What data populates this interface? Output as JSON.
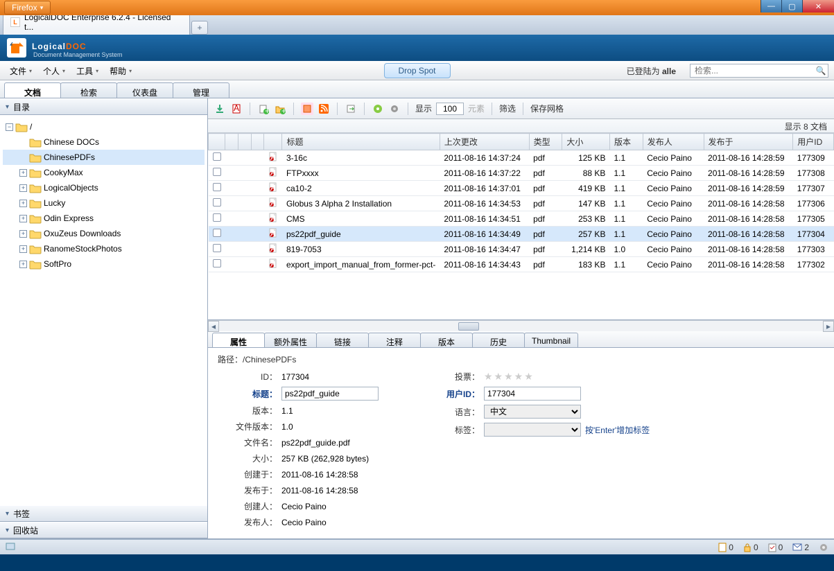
{
  "browser": {
    "name": "Firefox",
    "tab_title": "LogicalDOC Enterprise 6.2.4 - Licensed t..."
  },
  "logo": {
    "brand1": "Logical",
    "brand2": "DOC",
    "sub": "Document Management System"
  },
  "menus": {
    "file": "文件",
    "personal": "个人",
    "tools": "工具",
    "help": "帮助"
  },
  "dropspot": "Drop Spot",
  "login": {
    "prefix": "已登陆为 ",
    "user": "alle"
  },
  "search_placeholder": "检索...",
  "main_tabs": {
    "docs": "文档",
    "search": "检索",
    "dashboard": "仪表盘",
    "admin": "管理"
  },
  "sidebar": {
    "dir": "目录",
    "bookmarks": "书签",
    "trash": "回收站",
    "root": "/",
    "folders": [
      {
        "name": "Chinese DOCs",
        "expandable": false
      },
      {
        "name": "ChinesePDFs",
        "expandable": false,
        "selected": true
      },
      {
        "name": "CookyMax",
        "expandable": true
      },
      {
        "name": "LogicalObjects",
        "expandable": true
      },
      {
        "name": "Lucky",
        "expandable": true
      },
      {
        "name": "Odin Express",
        "expandable": true
      },
      {
        "name": "OxuZeus Downloads",
        "expandable": true
      },
      {
        "name": "RanomeStockPhotos",
        "expandable": true
      },
      {
        "name": "SoftPro",
        "expandable": true
      }
    ]
  },
  "toolbar": {
    "show": "显示",
    "page_size": "100",
    "elements": "元素",
    "filter": "筛选",
    "save_grid": "保存网格"
  },
  "count_text": "显示 8 文档",
  "columns": {
    "title": "标题",
    "modified": "上次更改",
    "type": "类型",
    "size": "大小",
    "version": "版本",
    "publisher": "发布人",
    "published": "发布于",
    "userid": "用户ID"
  },
  "rows": [
    {
      "title": "3-16c",
      "modified": "2011-08-16 14:37:24",
      "type": "pdf",
      "size": "125 KB",
      "version": "1.1",
      "pub": "Cecio Paino",
      "pubdate": "2011-08-16 14:28:59",
      "uid": "177309"
    },
    {
      "title": "FTPxxxx",
      "modified": "2011-08-16 14:37:22",
      "type": "pdf",
      "size": "88 KB",
      "version": "1.1",
      "pub": "Cecio Paino",
      "pubdate": "2011-08-16 14:28:59",
      "uid": "177308"
    },
    {
      "title": "ca10-2",
      "modified": "2011-08-16 14:37:01",
      "type": "pdf",
      "size": "419 KB",
      "version": "1.1",
      "pub": "Cecio Paino",
      "pubdate": "2011-08-16 14:28:59",
      "uid": "177307"
    },
    {
      "title": "Globus 3 Alpha 2 Installation",
      "modified": "2011-08-16 14:34:53",
      "type": "pdf",
      "size": "147 KB",
      "version": "1.1",
      "pub": "Cecio Paino",
      "pubdate": "2011-08-16 14:28:58",
      "uid": "177306"
    },
    {
      "title": "CMS",
      "modified": "2011-08-16 14:34:51",
      "type": "pdf",
      "size": "253 KB",
      "version": "1.1",
      "pub": "Cecio Paino",
      "pubdate": "2011-08-16 14:28:58",
      "uid": "177305"
    },
    {
      "title": "ps22pdf_guide",
      "modified": "2011-08-16 14:34:49",
      "type": "pdf",
      "size": "257 KB",
      "version": "1.1",
      "pub": "Cecio Paino",
      "pubdate": "2011-08-16 14:28:58",
      "uid": "177304",
      "selected": true
    },
    {
      "title": "819-7053",
      "modified": "2011-08-16 14:34:47",
      "type": "pdf",
      "size": "1,214 KB",
      "version": "1.0",
      "pub": "Cecio Paino",
      "pubdate": "2011-08-16 14:28:58",
      "uid": "177303"
    },
    {
      "title": "export_import_manual_from_former-pct-",
      "modified": "2011-08-16 14:34:43",
      "type": "pdf",
      "size": "183 KB",
      "version": "1.1",
      "pub": "Cecio Paino",
      "pubdate": "2011-08-16 14:28:58",
      "uid": "177302"
    }
  ],
  "detail_tabs": {
    "props": "属性",
    "ext": "额外属性",
    "links": "链接",
    "notes": "注释",
    "versions": "版本",
    "history": "历史",
    "thumb": "Thumbnail"
  },
  "detail": {
    "path_label": "路径：",
    "path": "/ChinesePDFs",
    "id_l": "ID：",
    "id": "177304",
    "title_l": "标题：",
    "title": "ps22pdf_guide",
    "ver_l": "版本：",
    "ver": "1.1",
    "filever_l": "文件版本：",
    "filever": "1.0",
    "filename_l": "文件名：",
    "filename": "ps22pdf_guide.pdf",
    "size_l": "大小：",
    "size": "257 KB (262,928 bytes)",
    "created_l": "创建于：",
    "created": "2011-08-16 14:28:58",
    "published_l": "发布于：",
    "published": "2011-08-16 14:28:58",
    "creator_l": "创建人：",
    "creator": "Cecio Paino",
    "publisher_l": "发布人：",
    "publisher": "Cecio Paino",
    "vote_l": "投票：",
    "uid_l": "用户ID：",
    "uid": "177304",
    "lang_l": "语言：",
    "lang": "中文",
    "tag_l": "标签：",
    "tag_hint": "按'Enter'增加标签"
  },
  "status": {
    "a": "0",
    "b": "0",
    "c": "0",
    "d": "2"
  }
}
